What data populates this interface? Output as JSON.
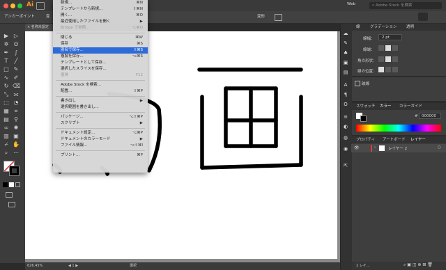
{
  "app": {
    "icon_text": "Ai",
    "workspace": "Web",
    "search_placeholder": "Adobe Stock を検索"
  },
  "control_bar": {
    "left_label": "アンカーポイント",
    "left_label2": "変",
    "transform_label": "変形"
  },
  "document": {
    "tab_title": "名称未設定"
  },
  "status": {
    "zoom": "626.45%",
    "tool": "選択"
  },
  "menu": {
    "items": [
      {
        "label": "新規...",
        "shortcut": "⌘N",
        "state": "normal"
      },
      {
        "label": "テンプレートから新規...",
        "shortcut": "⇧⌘N",
        "state": "normal"
      },
      {
        "label": "開く...",
        "shortcut": "⌘O",
        "state": "normal"
      },
      {
        "label": "最近使用したファイルを開く",
        "shortcut": "▶",
        "state": "normal"
      },
      {
        "label": "Bridge で参照...",
        "shortcut": "⌥⌘O",
        "state": "disabled"
      },
      {
        "sep": true
      },
      {
        "label": "閉じる",
        "shortcut": "⌘W",
        "state": "normal"
      },
      {
        "label": "保存",
        "shortcut": "⌘S",
        "state": "normal"
      },
      {
        "label": "別名で保存...",
        "shortcut": "⇧⌘S",
        "state": "highlighted"
      },
      {
        "label": "複製を保存...",
        "shortcut": "⌥⌘S",
        "state": "normal"
      },
      {
        "label": "テンプレートとして保存...",
        "shortcut": "",
        "state": "normal"
      },
      {
        "label": "選択したスライスを保存...",
        "shortcut": "",
        "state": "normal"
      },
      {
        "label": "復帰",
        "shortcut": "F12",
        "state": "disabled"
      },
      {
        "sep": true
      },
      {
        "label": "Adobe Stock を検索...",
        "shortcut": "",
        "state": "normal"
      },
      {
        "label": "配置...",
        "shortcut": "⇧⌘P",
        "state": "normal"
      },
      {
        "sep": true
      },
      {
        "label": "書き出し",
        "shortcut": "▶",
        "state": "normal"
      },
      {
        "label": "選択範囲を書き出し...",
        "shortcut": "",
        "state": "normal"
      },
      {
        "sep": true
      },
      {
        "label": "パッケージ...",
        "shortcut": "⌥⇧⌘P",
        "state": "normal"
      },
      {
        "label": "スクリプト",
        "shortcut": "▶",
        "state": "normal"
      },
      {
        "sep": true
      },
      {
        "label": "ドキュメント設定...",
        "shortcut": "⌥⌘P",
        "state": "normal"
      },
      {
        "label": "ドキュメントのカラーモード",
        "shortcut": "▶",
        "state": "normal"
      },
      {
        "label": "ファイル情報...",
        "shortcut": "⌥⇧⌘I",
        "state": "normal"
      },
      {
        "sep": true
      },
      {
        "label": "プリント...",
        "shortcut": "⌘P",
        "state": "normal"
      }
    ]
  },
  "stroke_panel": {
    "tabs": [
      "線",
      "グラデーション",
      "透明"
    ],
    "weight_label": "線幅：",
    "weight_value": "2 pt",
    "cap_label": "線端：",
    "corner_label": "角の形状：",
    "align_label": "線の位置："
  },
  "effects_label": "破線",
  "color_panel": {
    "tabs": [
      "スウォッチ",
      "カラー",
      "カラーガイド"
    ],
    "hex_prefix": "#",
    "hex_value": "000000"
  },
  "layers_panel": {
    "tabs": [
      "プロパティ",
      "アートボード",
      "レイヤー"
    ],
    "layer_name": "レイヤー 2",
    "layer_color": "#e23b3b",
    "footer": "1 レイ..."
  },
  "colors": {
    "highlight": "#2d6bd8",
    "brand": "#f7931e"
  }
}
